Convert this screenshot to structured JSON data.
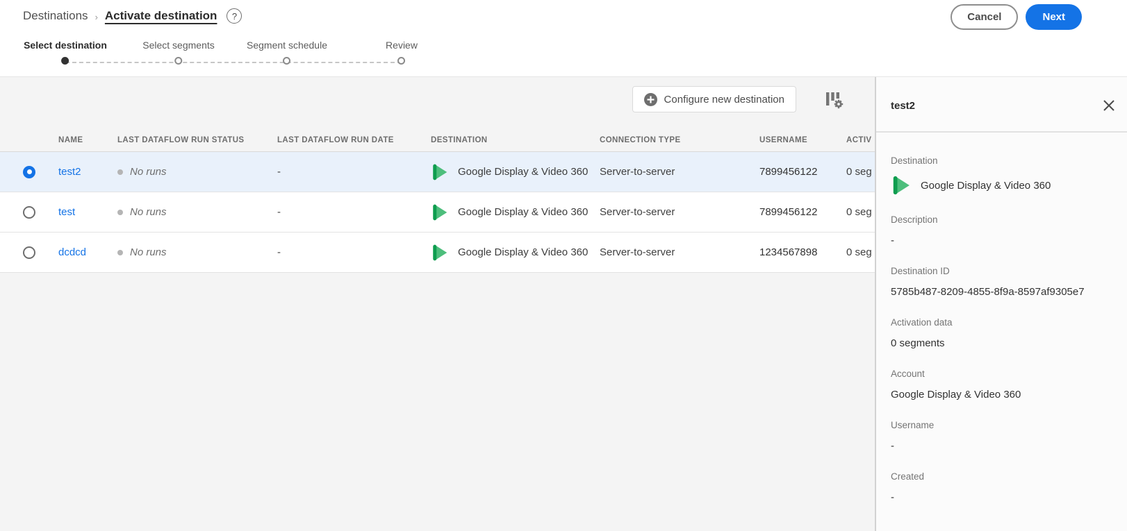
{
  "header": {
    "breadcrumb": {
      "root": "Destinations",
      "separator": "›",
      "current": "Activate destination"
    },
    "help_label": "?",
    "cancel_label": "Cancel",
    "next_label": "Next"
  },
  "stepper": {
    "steps": [
      {
        "label": "Select destination",
        "active": true
      },
      {
        "label": "Select segments",
        "active": false
      },
      {
        "label": "Segment schedule",
        "active": false
      },
      {
        "label": "Review",
        "active": false
      }
    ]
  },
  "toolbar": {
    "configure_label": "Configure new destination"
  },
  "table": {
    "columns": {
      "name": "NAME",
      "run_status": "LAST DATAFLOW RUN STATUS",
      "run_date": "LAST DATAFLOW RUN DATE",
      "destination": "DESTINATION",
      "connection": "CONNECTION TYPE",
      "username": "USERNAME",
      "activation": "ACTIV"
    },
    "rows": [
      {
        "name": "test2",
        "status": "No runs",
        "date": "-",
        "destination": "Google Display & Video 360",
        "connection": "Server-to-server",
        "username": "7899456122",
        "activation": "0 seg",
        "selected": true
      },
      {
        "name": "test",
        "status": "No runs",
        "date": "-",
        "destination": "Google Display & Video 360",
        "connection": "Server-to-server",
        "username": "7899456122",
        "activation": "0 seg",
        "selected": false
      },
      {
        "name": "dcdcd",
        "status": "No runs",
        "date": "-",
        "destination": "Google Display & Video 360",
        "connection": "Server-to-server",
        "username": "1234567898",
        "activation": "0 seg",
        "selected": false
      }
    ]
  },
  "panel": {
    "title": "test2",
    "fields": {
      "destination": {
        "label": "Destination",
        "value": "Google Display & Video 360"
      },
      "description": {
        "label": "Description",
        "value": "-"
      },
      "destination_id": {
        "label": "Destination ID",
        "value": "5785b487-8209-4855-8f9a-8597af9305e7"
      },
      "activation_data": {
        "label": "Activation data",
        "value": "0 segments"
      },
      "account": {
        "label": "Account",
        "value": "Google Display & Video 360"
      },
      "username": {
        "label": "Username",
        "value": "-"
      },
      "created": {
        "label": "Created",
        "value": "-"
      }
    }
  },
  "colors": {
    "accent_blue": "#1473E6",
    "link_blue": "#1473E6",
    "selected_row_bg": "#E9F1FB",
    "logo_green_dark": "#0E9D4F",
    "logo_green_light": "#4DBE7C",
    "main_bg": "#F4F4F4",
    "panel_bg": "#FBFBFB"
  }
}
